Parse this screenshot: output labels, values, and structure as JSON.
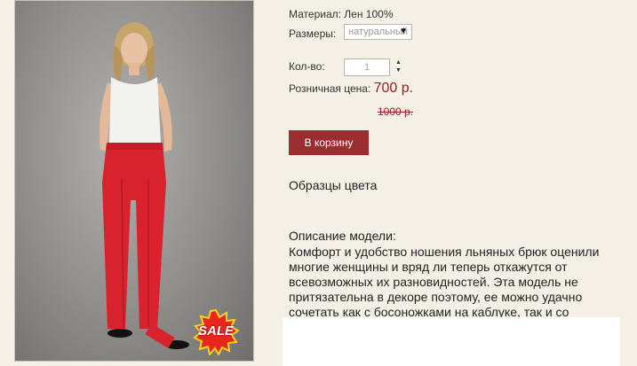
{
  "product": {
    "image_alt_icon": "product-photo",
    "sale_badge": "SALE",
    "material": "Материал: Лен 100%",
    "sizes_label": "Размеры:",
    "sizes_selected": "натуральный",
    "qty_label": "Кол-во:",
    "qty_value": "1",
    "price_label": "Розничная цена:",
    "price": "700 р.",
    "old_price": "1000 р.",
    "cart_button": "В корзину",
    "color_samples_title": "Образцы цвета",
    "description_title": "Описание модели:",
    "description_text": "Комфорт и удобство ношения льняных брюк оценили многие женщины и вряд ли теперь откажутся от всевозможных их разновидностей. Эта модель не притязательна в декоре поэтому, ее можно удачно сочетать как с босоножками на каблуке, так и со \"шлепками\"."
  },
  "colors": {
    "accent": "#9b2d30",
    "price": "#9b1c24",
    "background": "#f5f0e6"
  }
}
